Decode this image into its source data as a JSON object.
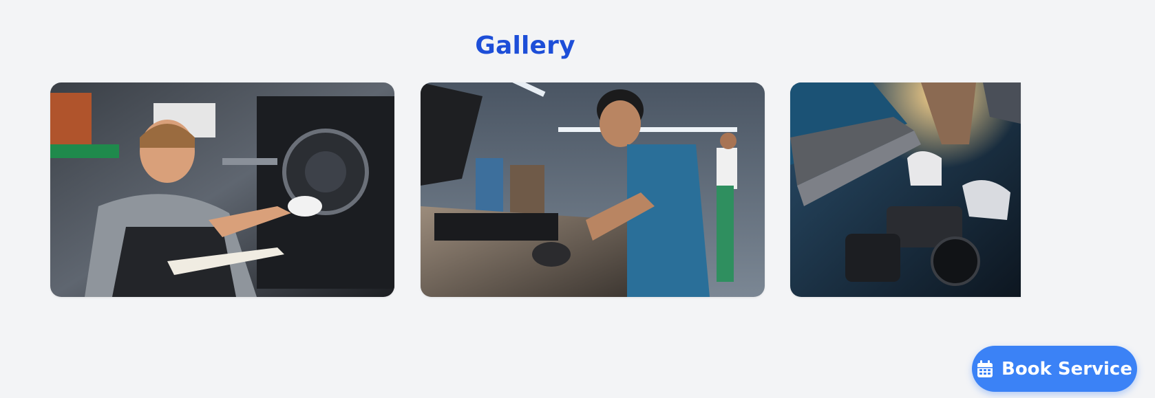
{
  "gallery": {
    "title": "Gallery",
    "images": [
      {
        "icon": "mechanic-motorcycle-photo"
      },
      {
        "icon": "mechanic-car-hood-photo"
      },
      {
        "icon": "engine-bay-photo"
      }
    ]
  },
  "cta": {
    "label": "Book Service",
    "icon": "calendar-icon"
  },
  "colors": {
    "accent": "#1d4ed8",
    "button": "#3b82f6",
    "background": "#f3f4f6"
  }
}
